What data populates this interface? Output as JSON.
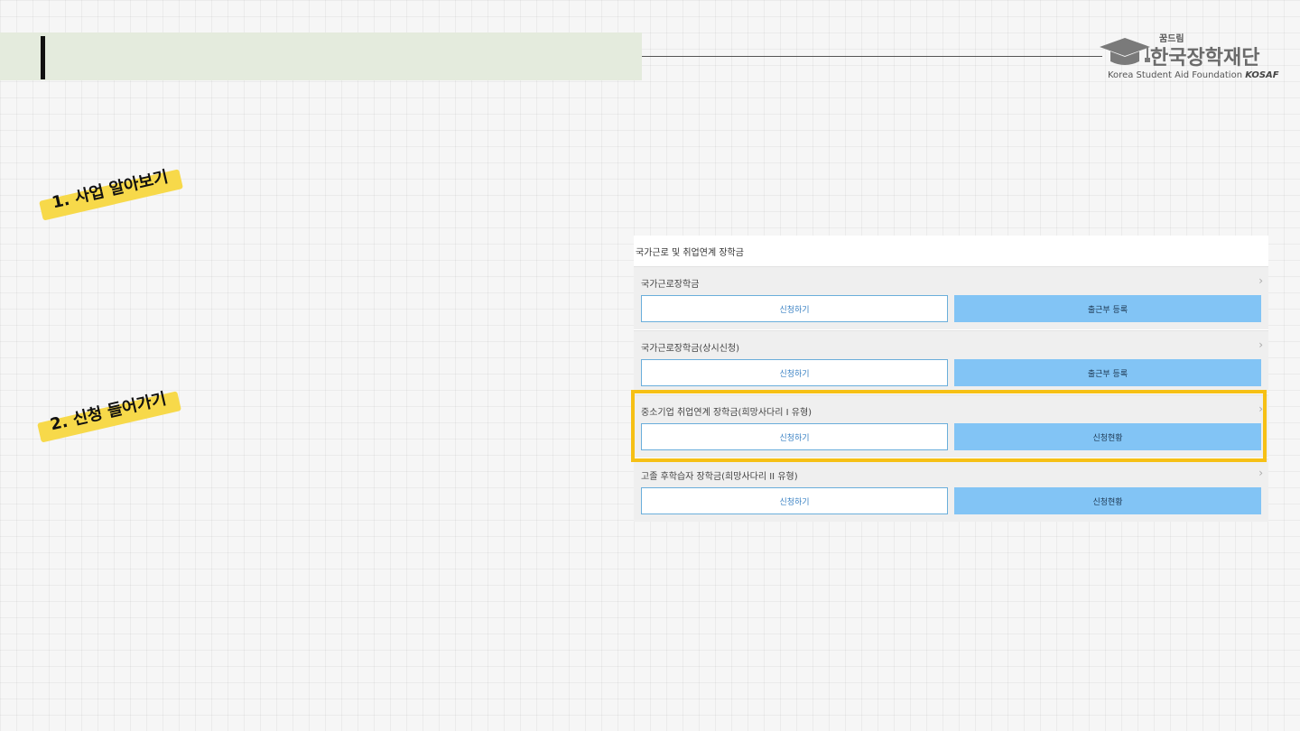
{
  "logo": {
    "tagline": "꿈드림",
    "name": "한국장학재단",
    "english": "Korea Student Aid Foundation",
    "abbr": "KOSAF"
  },
  "steps": [
    {
      "label": "1. 사업 알아보기"
    },
    {
      "label": "2. 신청 들어가기"
    }
  ],
  "panel": {
    "title": "국가근로 및 취업연계 장학금",
    "sections": [
      {
        "label": "국가근로장학금",
        "apply": "신청하기",
        "secondary": "출근부 등록"
      },
      {
        "label": "국가근로장학금(상시신청)",
        "apply": "신청하기",
        "secondary": "출근부 등록"
      },
      {
        "label": "중소기업 취업연계 장학금(희망사다리 I 유형)",
        "apply": "신청하기",
        "secondary": "신청현황"
      },
      {
        "label": "고졸 후학습자 장학금(희망사다리 II 유형)",
        "apply": "신청하기",
        "secondary": "신청현황"
      }
    ]
  },
  "colors": {
    "header_band": "#e4ebdd",
    "highlight": "#f6c015",
    "button_primary": "#82c4f5",
    "marker": "#f7d94a"
  },
  "icons": {
    "chevron": "chevron-right-icon",
    "logo": "graduation-cap-icon"
  }
}
